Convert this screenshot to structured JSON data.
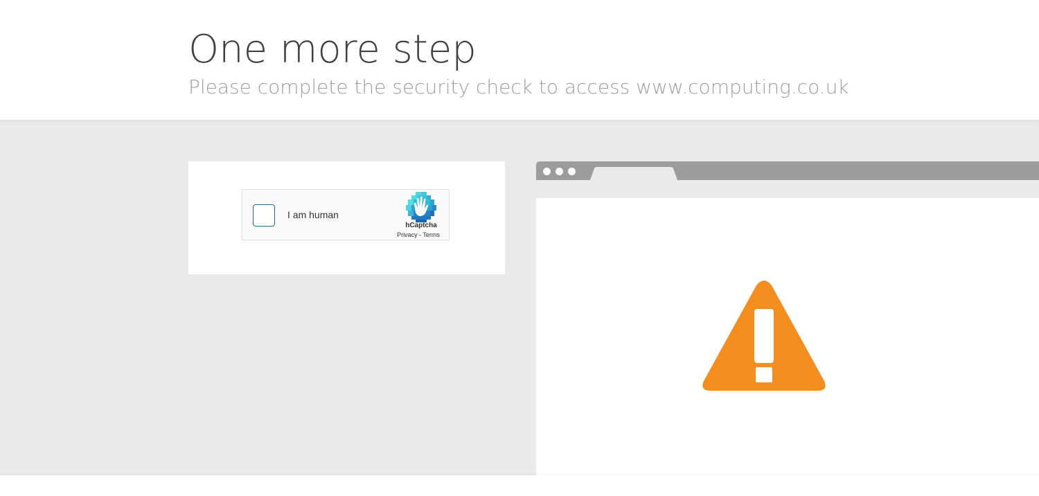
{
  "header": {
    "title": "One more step",
    "subtitle": "Please complete the security check to access www.computing.co.uk"
  },
  "captcha": {
    "checkbox_label": "I am human",
    "brand": "hCaptcha",
    "privacy_link": "Privacy",
    "separator": " - ",
    "terms_link": "Terms",
    "checked": false
  },
  "illustration": {
    "icon": "warning-icon",
    "warning_color": "#f48d20"
  },
  "colors": {
    "background_gray": "#eaeaea",
    "browser_chrome": "#9c9c9c",
    "title_text": "#404040",
    "subtitle_text": "#9e9e9e",
    "checkbox_border": "#1f6c7a"
  }
}
